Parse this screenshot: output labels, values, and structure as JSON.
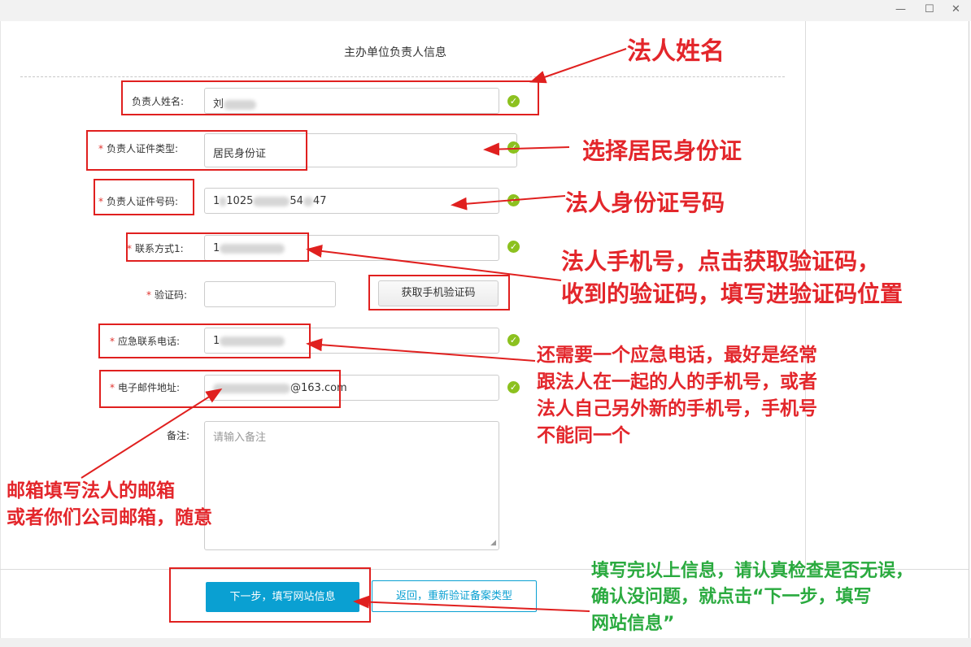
{
  "window": {
    "minimize": "—",
    "maximize": "☐",
    "close": "✕"
  },
  "section_title": "主办单位负责人信息",
  "fields": {
    "name": {
      "label": "负责人姓名:",
      "value": "刘",
      "valid": true
    },
    "id_type": {
      "label": "负责人证件类型:",
      "value": "居民身份证",
      "valid": true
    },
    "id_number": {
      "label": "负责人证件号码:",
      "value_start": "1",
      "value_mid": "1025",
      "value_mid2": "54",
      "value_end": "47",
      "valid": true
    },
    "phone": {
      "label": "联系方式1:",
      "value": "1",
      "valid": true
    },
    "code": {
      "label": "验证码:",
      "value": "",
      "button": "获取手机验证码"
    },
    "emergency": {
      "label": "应急联系电话:",
      "value": "1",
      "valid": true
    },
    "email": {
      "label": "电子邮件地址:",
      "value_end": "@163.com",
      "valid": true
    },
    "remark": {
      "label": "备注:",
      "placeholder": "请输入备注"
    }
  },
  "required_mark": "*",
  "check_icon": "✓",
  "buttons": {
    "next": "下一步，填写网站信息",
    "back": "返回，重新验证备案类型"
  },
  "annotations": {
    "legal_name": "法人姓名",
    "id_type": "选择居民身份证",
    "id_number": "法人身份证号码",
    "phone_line1": "法人手机号，点击获取验证码，",
    "phone_line2": "收到的验证码，填写进验证码位置",
    "emergency_line1": "还需要一个应急电话，最好是经常",
    "emergency_line2": "跟法人在一起的人的手机号，或者",
    "emergency_line3": "法人自己另外新的手机号，手机号",
    "emergency_line4": "不能同一个",
    "email_line1": "邮箱填写法人的邮箱",
    "email_line2": "或者你们公司邮箱，随意",
    "final_line1": "填写完以上信息，请认真检查是否无误，",
    "final_line2": "确认没问题，就点击“下一步，填写",
    "final_line3": "网站信息”"
  },
  "colors": {
    "annotation_red": "#e3262b",
    "annotation_green": "#2aaa3f",
    "primary": "#0aa0d2",
    "valid": "#8cc11f"
  }
}
